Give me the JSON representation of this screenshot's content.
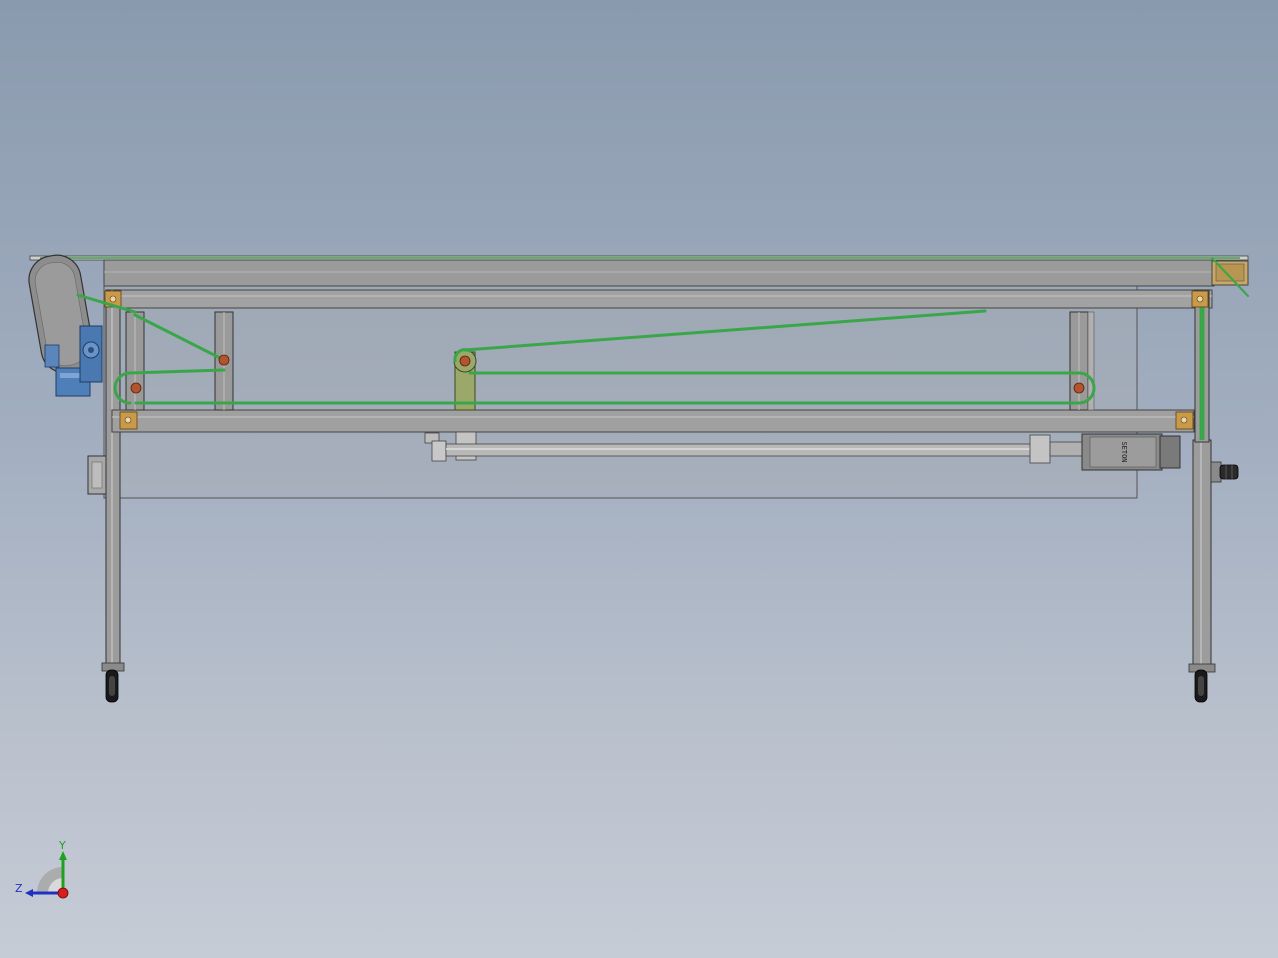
{
  "viewport": {
    "background_top": "#8a9aae",
    "background_bottom": "#c6ccd6"
  },
  "colors": {
    "frame": "#9a9a9a",
    "frame_dark": "#5a5a5a",
    "belt": "#3aa64a",
    "pulley_pin": "#b0552e",
    "bracket": "#c89a4a",
    "motor_blue": "#4f7fb8",
    "lever": "#9aa86a",
    "cylinder": "#b8b8b8",
    "servo": "#8a8a8a",
    "wheel": "#202020",
    "axis_x": "#d42020",
    "axis_y": "#20a020",
    "axis_z": "#2030c0"
  },
  "motor": {
    "label": "SETON"
  },
  "triad": {
    "y_label": "Y",
    "z_label": "Z"
  }
}
